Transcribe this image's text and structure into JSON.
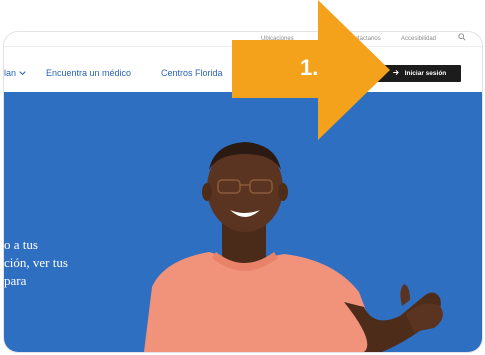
{
  "utility": {
    "locations": "Ubicaciones",
    "contact": "Contáctanos",
    "accessibility": "Accesibilidad"
  },
  "nav": {
    "plan_partial": "lan",
    "find_doctor": "Encuentra un médico",
    "centers": "Centros Florida",
    "login": "Iniciar sesión"
  },
  "hero": {
    "lines": [
      "o a tus",
      "ción, ver tus",
      "para"
    ]
  },
  "annotation": {
    "step": "1."
  },
  "colors": {
    "hero_blue": "#2f6fc2",
    "arrow_orange": "#f4a21c",
    "link_blue": "#2a63b8",
    "button_dark": "#1c1c1c"
  }
}
